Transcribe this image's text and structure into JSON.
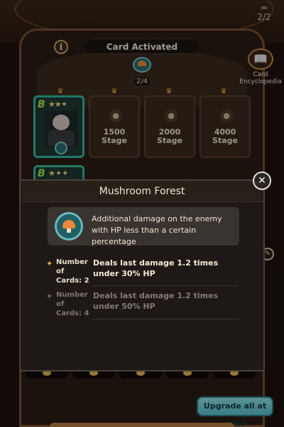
{
  "header": {
    "stage_counter": "2/2",
    "panel_title": "Card Activated",
    "activation_count": "2/4",
    "encyclopedia_label": "Card Encyclopedia"
  },
  "cards": [
    {
      "grade": "B",
      "stars": "★★✦",
      "state": "active"
    },
    {
      "grade": "",
      "stars": "",
      "state": "locked",
      "stage_label": "1500 Stage"
    },
    {
      "grade": "",
      "stars": "",
      "state": "locked",
      "stage_label": "2000 Stage"
    },
    {
      "grade": "",
      "stars": "",
      "state": "locked",
      "stage_label": "4000 Stage"
    }
  ],
  "second_row": {
    "grade": "B",
    "stars": "★✦✦"
  },
  "modal": {
    "title": "Mushroom Forest",
    "close_label": "✕",
    "effect_description": "Additional damage on the enemy with HP less than a certain percentage",
    "tiers": [
      {
        "label": "Number of Cards: 2",
        "description": "Deals last damage 1.2 times under 30% HP",
        "active": true
      },
      {
        "label": "Number of Cards: 4",
        "description": "Deals last damage 1.2 times under 50% HP",
        "active": false
      }
    ]
  },
  "footer": {
    "upgrade_all_label": "Upgrade all at once"
  },
  "icons": {
    "info": "i",
    "lock": "🔒",
    "book": "📖",
    "crown": "♛",
    "edit": "✎"
  },
  "colors": {
    "active_border": "#34b8a0",
    "grade_color": "#a6e64a",
    "upgrade_button": "#6fd0d8"
  }
}
